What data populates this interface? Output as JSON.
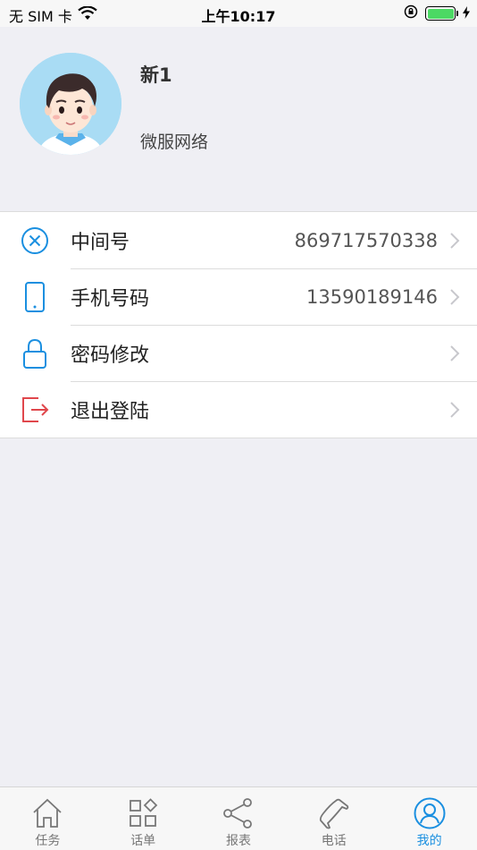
{
  "status_bar": {
    "carrier": "无 SIM 卡",
    "wifi_icon": "wifi-icon",
    "time": "上午10:17",
    "lock_icon": "orientation-lock-icon",
    "battery_icon": "battery-icon",
    "charging_icon": "charging-bolt-icon"
  },
  "profile": {
    "avatar_icon": "user-avatar",
    "name": "新1",
    "company": "微服网络"
  },
  "menu": {
    "items": [
      {
        "icon": "circle-x-icon",
        "label": "中间号",
        "value": "869717570338",
        "icon_color": "#1a8fe0"
      },
      {
        "icon": "phone-device-icon",
        "label": "手机号码",
        "value": "13590189146",
        "icon_color": "#1a8fe0"
      },
      {
        "icon": "lock-icon",
        "label": "密码修改",
        "value": "",
        "icon_color": "#1a8fe0"
      },
      {
        "icon": "logout-icon",
        "label": "退出登陆",
        "value": "",
        "icon_color": "#e0474c"
      }
    ]
  },
  "tab_bar": {
    "tabs": [
      {
        "icon": "home-icon",
        "label": "任务",
        "active": false
      },
      {
        "icon": "grid-icon",
        "label": "话单",
        "active": false
      },
      {
        "icon": "share-icon",
        "label": "报表",
        "active": false
      },
      {
        "icon": "phone-icon",
        "label": "电话",
        "active": false
      },
      {
        "icon": "user-icon",
        "label": "我的",
        "active": true
      }
    ],
    "active_color": "#1a8fe0",
    "inactive_color": "#777777"
  }
}
